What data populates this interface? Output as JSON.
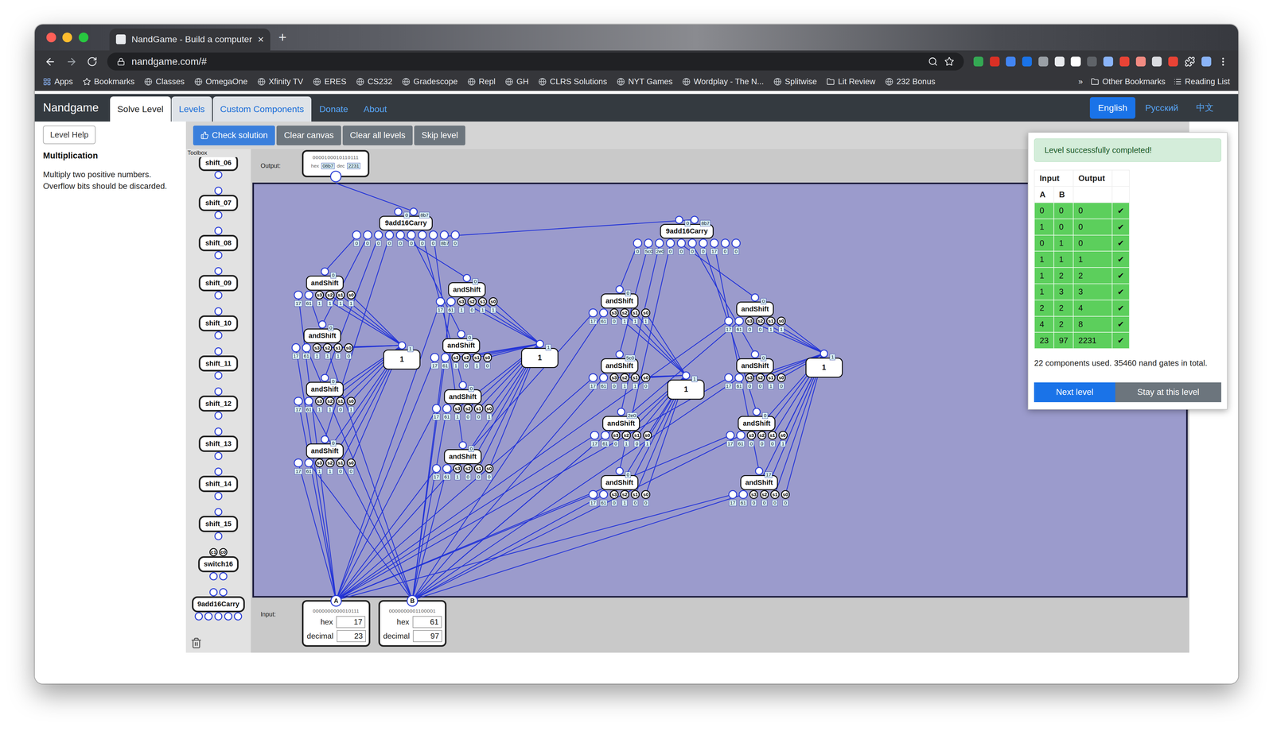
{
  "browser": {
    "tabs": [
      {
        "label": "NandGame - Build a computer",
        "selected": true,
        "close": "×"
      }
    ],
    "new_tab": "+",
    "url": "nandgame.com/#",
    "bookmarks": [
      {
        "label": "Apps",
        "kind": "apps"
      },
      {
        "label": "Bookmarks",
        "kind": "star"
      },
      {
        "label": "Classes",
        "kind": "site"
      },
      {
        "label": "OmegaOne",
        "kind": "site"
      },
      {
        "label": "Xfinity TV",
        "kind": "site"
      },
      {
        "label": "ERES",
        "kind": "site"
      },
      {
        "label": "CS232",
        "kind": "site"
      },
      {
        "label": "Gradescope",
        "kind": "site"
      },
      {
        "label": "Repl",
        "kind": "site"
      },
      {
        "label": "GH",
        "kind": "site"
      },
      {
        "label": "CLRS Solutions",
        "kind": "site"
      },
      {
        "label": "NYT Games",
        "kind": "site"
      },
      {
        "label": "Wordplay - The N...",
        "kind": "site"
      },
      {
        "label": "Splitwise",
        "kind": "site"
      },
      {
        "label": "Lit Review",
        "kind": "folder"
      },
      {
        "label": "232 Bonus",
        "kind": "site"
      }
    ],
    "more": "»",
    "other_bookmarks": [
      {
        "label": "Other Bookmarks",
        "kind": "folder"
      },
      {
        "label": "Reading List",
        "kind": "list"
      }
    ]
  },
  "nav": {
    "brand": "Nandgame",
    "tabs": [
      {
        "label": "Solve Level",
        "selected": true,
        "kind": "tab"
      },
      {
        "label": "Levels",
        "selected": false,
        "kind": "tab"
      },
      {
        "label": "Custom Components",
        "selected": false,
        "kind": "tab"
      },
      {
        "label": "Donate",
        "selected": false,
        "kind": "link"
      },
      {
        "label": "About",
        "selected": false,
        "kind": "link"
      }
    ],
    "languages": [
      {
        "label": "English",
        "selected": true
      },
      {
        "label": "Русский",
        "selected": false
      },
      {
        "label": "中文",
        "selected": false
      }
    ]
  },
  "sidebar": {
    "help_button": "Level Help",
    "title": "Multiplication",
    "description": "Multiply two positive numbers. Overflow bits should be discarded."
  },
  "toolbar": {
    "buttons": [
      {
        "label": "Check solution",
        "primary": true
      },
      {
        "label": "Clear canvas",
        "primary": false
      },
      {
        "label": "Clear all levels",
        "primary": false
      },
      {
        "label": "Skip level",
        "primary": false
      }
    ]
  },
  "toolbox": {
    "label": "Toolbox",
    "items": [
      {
        "name": "shift_06",
        "kind": "shift"
      },
      {
        "name": "shift_07",
        "kind": "shift"
      },
      {
        "name": "shift_08",
        "kind": "shift"
      },
      {
        "name": "shift_09",
        "kind": "shift"
      },
      {
        "name": "shift_10",
        "kind": "shift"
      },
      {
        "name": "shift_11",
        "kind": "shift"
      },
      {
        "name": "shift_12",
        "kind": "shift"
      },
      {
        "name": "shift_13",
        "kind": "shift"
      },
      {
        "name": "shift_14",
        "kind": "shift"
      },
      {
        "name": "shift_15",
        "kind": "shift"
      },
      {
        "name": "switch16",
        "kind": "switch",
        "pins": [
          "c1",
          "c0"
        ]
      },
      {
        "name": "9add16Carry",
        "kind": "adder"
      }
    ]
  },
  "output": {
    "label": "Output:",
    "binary": "0000100010110111",
    "hex_label": "hex",
    "hex": "08b7",
    "dec_label": "dec",
    "dec": "2231"
  },
  "inputs": {
    "label": "Input:",
    "items": [
      {
        "pin": "A",
        "binary": "0000000000010111",
        "hex_label": "hex",
        "hex": "17",
        "dec_label": "decimal",
        "dec": "23"
      },
      {
        "pin": "B",
        "binary": "0000000001100001",
        "hex_label": "hex",
        "hex": "61",
        "dec_label": "decimal",
        "dec": "97"
      }
    ]
  },
  "canvas": {
    "shift_pins": [
      "s3",
      "s2",
      "s1",
      "s0"
    ],
    "adders": [
      {
        "name": "9add16Carry",
        "outputs": [
          "0",
          "8b7"
        ],
        "inputs": [
          "0",
          "0",
          "0",
          "0",
          "0",
          "0",
          "0",
          "0",
          "8b7",
          "0"
        ]
      },
      {
        "name": "9add16Carry",
        "outputs": [
          "0",
          "8b7"
        ],
        "inputs": [
          "0",
          "5c0",
          "2e0",
          "0",
          "0",
          "0",
          "0",
          "17",
          "0",
          "0"
        ]
      }
    ],
    "and_shifts": [
      {
        "name": "andShift",
        "output": "0",
        "inputs": [
          "17",
          "61",
          "1",
          "1",
          "1",
          "1"
        ]
      },
      {
        "name": "andShift",
        "output": "0",
        "inputs": [
          "17",
          "61",
          "1",
          "1",
          "1",
          "0"
        ]
      },
      {
        "name": "andShift",
        "output": "0",
        "inputs": [
          "17",
          "61",
          "1",
          "1",
          "0",
          "1"
        ]
      },
      {
        "name": "andShift",
        "output": "0",
        "inputs": [
          "17",
          "61",
          "1",
          "1",
          "0",
          "0"
        ]
      },
      {
        "name": "andShift",
        "output": "0",
        "inputs": [
          "17",
          "61",
          "1",
          "0",
          "1",
          "1"
        ]
      },
      {
        "name": "andShift",
        "output": "0",
        "inputs": [
          "17",
          "61",
          "1",
          "0",
          "1",
          "0"
        ]
      },
      {
        "name": "andShift",
        "output": "0",
        "inputs": [
          "17",
          "61",
          "1",
          "0",
          "0",
          "1"
        ]
      },
      {
        "name": "andShift",
        "output": "0",
        "inputs": [
          "17",
          "61",
          "1",
          "0",
          "0",
          "0"
        ]
      },
      {
        "name": "andShift",
        "output": "0",
        "inputs": [
          "17",
          "61",
          "0",
          "1",
          "1",
          "1"
        ]
      },
      {
        "name": "andShift",
        "output": "5c0",
        "inputs": [
          "17",
          "61",
          "0",
          "1",
          "1",
          "0"
        ]
      },
      {
        "name": "andShift",
        "output": "2e0",
        "inputs": [
          "17",
          "61",
          "0",
          "1",
          "0",
          "1"
        ]
      },
      {
        "name": "andShift",
        "output": "0",
        "inputs": [
          "17",
          "61",
          "0",
          "1",
          "0",
          "0"
        ]
      },
      {
        "name": "andShift",
        "output": "0",
        "inputs": [
          "17",
          "61",
          "0",
          "0",
          "1",
          "1"
        ]
      },
      {
        "name": "andShift",
        "output": "0",
        "inputs": [
          "17",
          "61",
          "0",
          "0",
          "1",
          "0"
        ]
      },
      {
        "name": "andShift",
        "output": "0",
        "inputs": [
          "17",
          "61",
          "0",
          "0",
          "0",
          "1"
        ]
      },
      {
        "name": "andShift",
        "output": "17",
        "inputs": [
          "17",
          "61",
          "0",
          "0",
          "0",
          "0"
        ]
      }
    ],
    "constants": [
      {
        "value": "1",
        "output": "1"
      },
      {
        "value": "1",
        "output": "1"
      },
      {
        "value": "1",
        "output": "1"
      },
      {
        "value": "1",
        "output": "1"
      }
    ]
  },
  "result": {
    "message": "Level successfully completed!",
    "headers": [
      "Input",
      "Output"
    ],
    "subheaders": [
      "A",
      "B"
    ],
    "rows": [
      {
        "a": "0",
        "b": "0",
        "out": "0",
        "passed": true,
        "mark": "✔"
      },
      {
        "a": "1",
        "b": "0",
        "out": "0",
        "passed": true,
        "mark": "✔"
      },
      {
        "a": "0",
        "b": "1",
        "out": "0",
        "passed": true,
        "mark": "✔"
      },
      {
        "a": "1",
        "b": "1",
        "out": "1",
        "passed": true,
        "mark": "✔"
      },
      {
        "a": "1",
        "b": "2",
        "out": "2",
        "passed": true,
        "mark": "✔"
      },
      {
        "a": "1",
        "b": "3",
        "out": "3",
        "passed": true,
        "mark": "✔"
      },
      {
        "a": "2",
        "b": "2",
        "out": "4",
        "passed": true,
        "mark": "✔"
      },
      {
        "a": "4",
        "b": "2",
        "out": "8",
        "passed": true,
        "mark": "✔"
      },
      {
        "a": "23",
        "b": "97",
        "out": "2231",
        "passed": true,
        "mark": "✔"
      }
    ],
    "summary": "22 components used. 35460 nand gates in total.",
    "buttons": [
      {
        "label": "Next level",
        "primary": true
      },
      {
        "label": "Stay at this level",
        "primary": false
      }
    ]
  }
}
